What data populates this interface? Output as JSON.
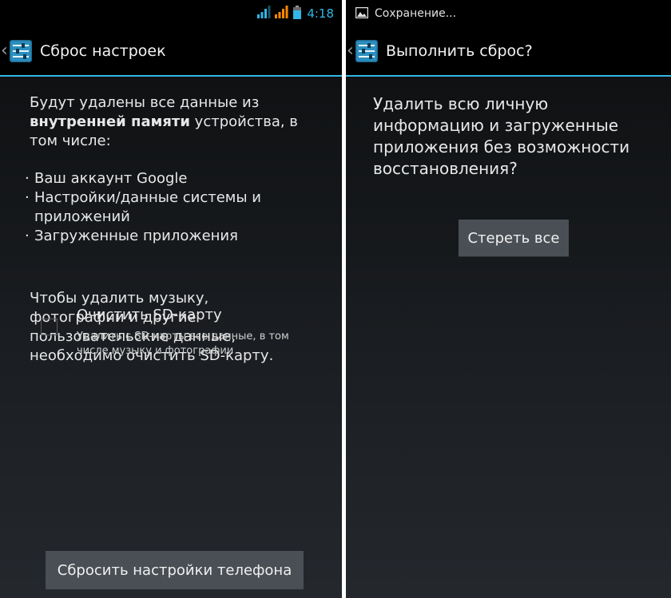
{
  "left": {
    "status_bar": {
      "time": "4:18"
    },
    "action_bar": {
      "title": "Сброс настроек"
    },
    "intro": {
      "part1": "Будут удалены все данные из ",
      "bold": "внутренней памяти",
      "part2": " устройства, в том числе:"
    },
    "bullets": [
      "Ваш аккаунт Google",
      "Настройки/данные системы и приложений",
      "Загруженные приложения"
    ],
    "sd_note": "Чтобы удалить музыку, фотографии и другие пользовательские данные, необходимо очистить SD-карту.",
    "checkbox": {
      "title": "Очистить SD-карту",
      "subtitle": "Удалить с SD-карты все данные, в том числе музыку и фотографии",
      "checked": false
    },
    "reset_button": "Сбросить настройки телефона"
  },
  "right": {
    "status_bar": {
      "notification": "Сохранение..."
    },
    "action_bar": {
      "title": "Выполнить сброс?"
    },
    "question": "Удалить всю личную информацию и загруженные приложения без возможности восстановления?",
    "erase_button": "Стереть все"
  },
  "colors": {
    "accent": "#33b5e5",
    "button": "#4a4f55",
    "background_top": "#0b0b0b",
    "background_bottom": "#24282d"
  }
}
